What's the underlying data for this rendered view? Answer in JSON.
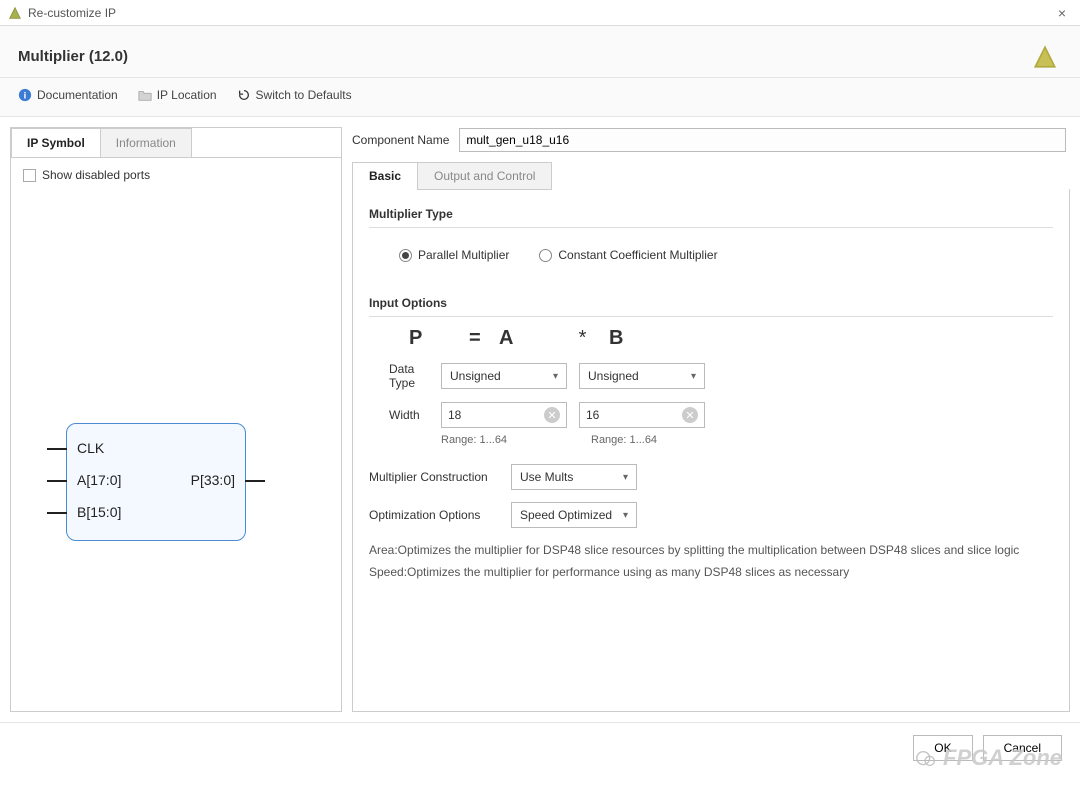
{
  "window": {
    "title": "Re-customize IP",
    "close": "×"
  },
  "header": {
    "title": "Multiplier (12.0)"
  },
  "toolbar": {
    "doc": "Documentation",
    "iploc": "IP Location",
    "reset": "Switch to Defaults"
  },
  "left": {
    "tabs": {
      "symbol": "IP Symbol",
      "info": "Information"
    },
    "show_disabled": "Show disabled ports",
    "ports": {
      "clk": "CLK",
      "a": "A[17:0]",
      "b": "B[15:0]",
      "p": "P[33:0]"
    }
  },
  "right": {
    "comp_name_label": "Component Name",
    "comp_name_value": "mult_gen_u18_u16",
    "tabs": {
      "basic": "Basic",
      "outctl": "Output and Control"
    },
    "mult_type_title": "Multiplier Type",
    "radios": {
      "parallel": "Parallel Multiplier",
      "ccm": "Constant Coefficient Multiplier"
    },
    "input_opts_title": "Input Options",
    "formula": {
      "P": "P",
      "eq": "=",
      "A": "A",
      "star": "*",
      "B": "B"
    },
    "data_type_label": "Data Type",
    "data_type_a": "Unsigned",
    "data_type_b": "Unsigned",
    "width_label": "Width",
    "width_a": "18",
    "width_b": "16",
    "range_a": "Range: 1...64",
    "range_b": "Range: 1...64",
    "construction_label": "Multiplier Construction",
    "construction_value": "Use Mults",
    "opt_label": "Optimization Options",
    "opt_value": "Speed Optimized",
    "note_area": "Area:Optimizes the multiplier for DSP48 slice resources by splitting the multiplication between DSP48 slices and slice logic",
    "note_speed": "Speed:Optimizes the multiplier for performance using as many DSP48 slices as necessary"
  },
  "buttons": {
    "ok": "OK",
    "cancel": "Cancel"
  },
  "watermark": "FPGA Zone"
}
